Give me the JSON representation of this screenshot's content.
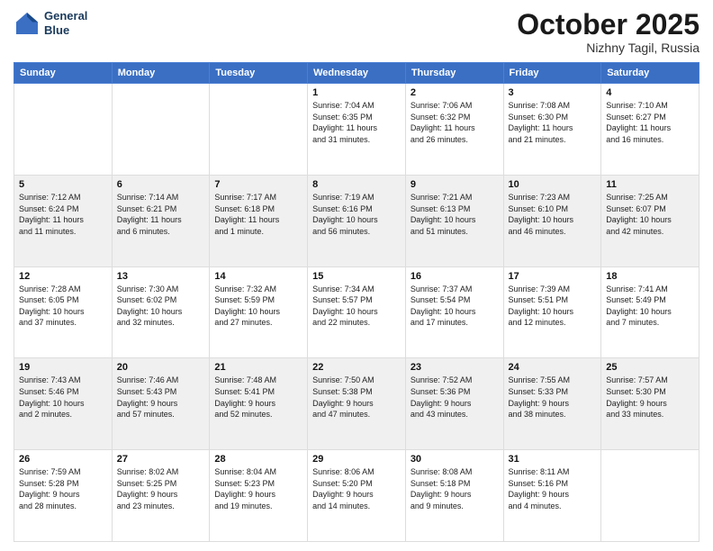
{
  "logo": {
    "line1": "General",
    "line2": "Blue"
  },
  "title": "October 2025",
  "location": "Nizhny Tagil, Russia",
  "days_header": [
    "Sunday",
    "Monday",
    "Tuesday",
    "Wednesday",
    "Thursday",
    "Friday",
    "Saturday"
  ],
  "weeks": [
    [
      {
        "day": "",
        "info": ""
      },
      {
        "day": "",
        "info": ""
      },
      {
        "day": "",
        "info": ""
      },
      {
        "day": "1",
        "info": "Sunrise: 7:04 AM\nSunset: 6:35 PM\nDaylight: 11 hours\nand 31 minutes."
      },
      {
        "day": "2",
        "info": "Sunrise: 7:06 AM\nSunset: 6:32 PM\nDaylight: 11 hours\nand 26 minutes."
      },
      {
        "day": "3",
        "info": "Sunrise: 7:08 AM\nSunset: 6:30 PM\nDaylight: 11 hours\nand 21 minutes."
      },
      {
        "day": "4",
        "info": "Sunrise: 7:10 AM\nSunset: 6:27 PM\nDaylight: 11 hours\nand 16 minutes."
      }
    ],
    [
      {
        "day": "5",
        "info": "Sunrise: 7:12 AM\nSunset: 6:24 PM\nDaylight: 11 hours\nand 11 minutes."
      },
      {
        "day": "6",
        "info": "Sunrise: 7:14 AM\nSunset: 6:21 PM\nDaylight: 11 hours\nand 6 minutes."
      },
      {
        "day": "7",
        "info": "Sunrise: 7:17 AM\nSunset: 6:18 PM\nDaylight: 11 hours\nand 1 minute."
      },
      {
        "day": "8",
        "info": "Sunrise: 7:19 AM\nSunset: 6:16 PM\nDaylight: 10 hours\nand 56 minutes."
      },
      {
        "day": "9",
        "info": "Sunrise: 7:21 AM\nSunset: 6:13 PM\nDaylight: 10 hours\nand 51 minutes."
      },
      {
        "day": "10",
        "info": "Sunrise: 7:23 AM\nSunset: 6:10 PM\nDaylight: 10 hours\nand 46 minutes."
      },
      {
        "day": "11",
        "info": "Sunrise: 7:25 AM\nSunset: 6:07 PM\nDaylight: 10 hours\nand 42 minutes."
      }
    ],
    [
      {
        "day": "12",
        "info": "Sunrise: 7:28 AM\nSunset: 6:05 PM\nDaylight: 10 hours\nand 37 minutes."
      },
      {
        "day": "13",
        "info": "Sunrise: 7:30 AM\nSunset: 6:02 PM\nDaylight: 10 hours\nand 32 minutes."
      },
      {
        "day": "14",
        "info": "Sunrise: 7:32 AM\nSunset: 5:59 PM\nDaylight: 10 hours\nand 27 minutes."
      },
      {
        "day": "15",
        "info": "Sunrise: 7:34 AM\nSunset: 5:57 PM\nDaylight: 10 hours\nand 22 minutes."
      },
      {
        "day": "16",
        "info": "Sunrise: 7:37 AM\nSunset: 5:54 PM\nDaylight: 10 hours\nand 17 minutes."
      },
      {
        "day": "17",
        "info": "Sunrise: 7:39 AM\nSunset: 5:51 PM\nDaylight: 10 hours\nand 12 minutes."
      },
      {
        "day": "18",
        "info": "Sunrise: 7:41 AM\nSunset: 5:49 PM\nDaylight: 10 hours\nand 7 minutes."
      }
    ],
    [
      {
        "day": "19",
        "info": "Sunrise: 7:43 AM\nSunset: 5:46 PM\nDaylight: 10 hours\nand 2 minutes."
      },
      {
        "day": "20",
        "info": "Sunrise: 7:46 AM\nSunset: 5:43 PM\nDaylight: 9 hours\nand 57 minutes."
      },
      {
        "day": "21",
        "info": "Sunrise: 7:48 AM\nSunset: 5:41 PM\nDaylight: 9 hours\nand 52 minutes."
      },
      {
        "day": "22",
        "info": "Sunrise: 7:50 AM\nSunset: 5:38 PM\nDaylight: 9 hours\nand 47 minutes."
      },
      {
        "day": "23",
        "info": "Sunrise: 7:52 AM\nSunset: 5:36 PM\nDaylight: 9 hours\nand 43 minutes."
      },
      {
        "day": "24",
        "info": "Sunrise: 7:55 AM\nSunset: 5:33 PM\nDaylight: 9 hours\nand 38 minutes."
      },
      {
        "day": "25",
        "info": "Sunrise: 7:57 AM\nSunset: 5:30 PM\nDaylight: 9 hours\nand 33 minutes."
      }
    ],
    [
      {
        "day": "26",
        "info": "Sunrise: 7:59 AM\nSunset: 5:28 PM\nDaylight: 9 hours\nand 28 minutes."
      },
      {
        "day": "27",
        "info": "Sunrise: 8:02 AM\nSunset: 5:25 PM\nDaylight: 9 hours\nand 23 minutes."
      },
      {
        "day": "28",
        "info": "Sunrise: 8:04 AM\nSunset: 5:23 PM\nDaylight: 9 hours\nand 19 minutes."
      },
      {
        "day": "29",
        "info": "Sunrise: 8:06 AM\nSunset: 5:20 PM\nDaylight: 9 hours\nand 14 minutes."
      },
      {
        "day": "30",
        "info": "Sunrise: 8:08 AM\nSunset: 5:18 PM\nDaylight: 9 hours\nand 9 minutes."
      },
      {
        "day": "31",
        "info": "Sunrise: 8:11 AM\nSunset: 5:16 PM\nDaylight: 9 hours\nand 4 minutes."
      },
      {
        "day": "",
        "info": ""
      }
    ]
  ]
}
